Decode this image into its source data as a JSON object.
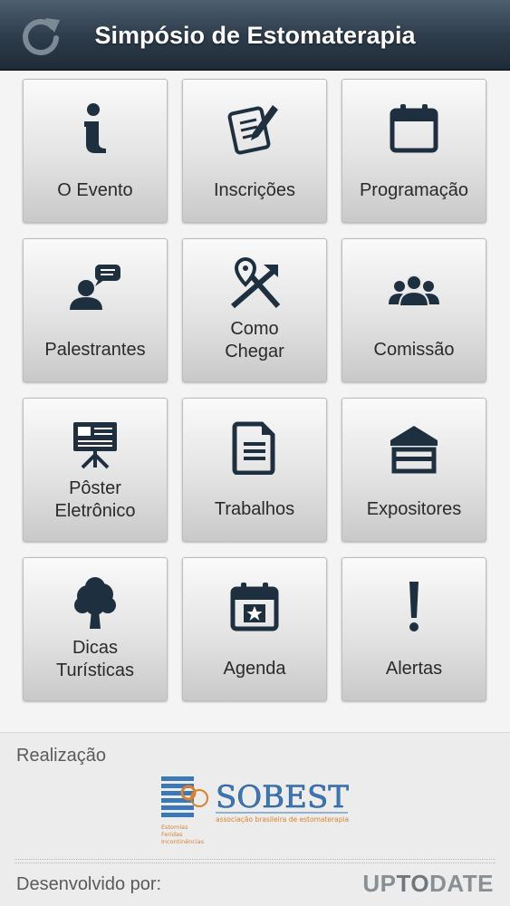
{
  "header": {
    "title": "Simpósio de Estomaterapia",
    "refresh_icon": "refresh-icon"
  },
  "menu": [
    {
      "label": "O Evento",
      "icon": "info-icon"
    },
    {
      "label": "Inscrições",
      "icon": "form-pen-icon"
    },
    {
      "label": "Programação",
      "icon": "calendar-icon"
    },
    {
      "label": "Palestrantes",
      "icon": "speaker-icon"
    },
    {
      "label": "Como\nChegar",
      "icon": "map-directions-icon"
    },
    {
      "label": "Comissão",
      "icon": "group-icon"
    },
    {
      "label": "Pôster\nEletrônico",
      "icon": "presentation-board-icon"
    },
    {
      "label": "Trabalhos",
      "icon": "document-icon"
    },
    {
      "label": "Expositores",
      "icon": "booth-icon"
    },
    {
      "label": "Dicas\nTurísticas",
      "icon": "tree-icon"
    },
    {
      "label": "Agenda",
      "icon": "calendar-star-icon"
    },
    {
      "label": "Alertas",
      "icon": "exclamation-icon"
    }
  ],
  "footer": {
    "realizacao": "Realização",
    "logo_name": "SOBEST",
    "logo_tagline": "associação brasileira de estomaterapia",
    "logo_side": [
      "Estomias",
      "Feridas",
      "Incontinências"
    ],
    "developed_by": "Desenvolvido por:",
    "developer_up": "UP",
    "developer_to": "TO",
    "developer_date": "DATE"
  },
  "colors": {
    "header_dark": "#1f2b37",
    "icon": "#1e2f40",
    "logo_blue": "#3a78b8",
    "logo_orange": "#d9822b"
  }
}
